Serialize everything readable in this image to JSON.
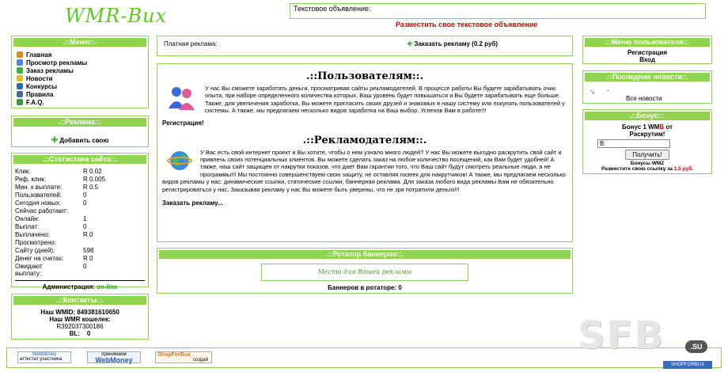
{
  "header": {
    "logo": "WMR-Bux",
    "ad_label": "Текстовое объявление:",
    "ad_link": "Разместить свое текстовое объявление"
  },
  "left": {
    "menu": {
      "title": ".::Меню::.",
      "items": [
        {
          "label": "Главная",
          "icon": "home-icon",
          "color": "#d98a20"
        },
        {
          "label": "Просмотр рекламы",
          "icon": "view-ads-icon",
          "color": "#4a8ad4"
        },
        {
          "label": "Заказ рекламы",
          "icon": "order-icon",
          "color": "#3cb33c"
        },
        {
          "label": "Новости",
          "icon": "news-icon",
          "color": "#e0c020"
        },
        {
          "label": "Конкурсы",
          "icon": "contest-icon",
          "color": "#2a6ab8"
        },
        {
          "label": "Правила",
          "icon": "rules-icon",
          "color": "#4a6a9a"
        },
        {
          "label": "F.A.Q.",
          "icon": "faq-icon",
          "color": "#3c9a3c"
        }
      ]
    },
    "ads": {
      "title": ".::Реклама::.",
      "add": "Добавить свою"
    },
    "stats": {
      "title": ".::Статистика сайта::.",
      "rows": [
        {
          "k": "Клик:",
          "v": "R 0.02"
        },
        {
          "k": "Реф. клик:",
          "v": "R 0.005"
        },
        {
          "k": "Мин. к выплате:",
          "v": "R 0.5"
        },
        {
          "k": "Пользователей:",
          "v": "0"
        },
        {
          "k": "Сегодня новых:",
          "v": "0"
        },
        {
          "k": "Сейчас работают:",
          "v": ""
        },
        {
          "k": "Онлайн:",
          "v": "1"
        },
        {
          "k": "Выплат:",
          "v": "0"
        },
        {
          "k": "Выплачено:",
          "v": "R 0"
        },
        {
          "k": "Просмотрено:",
          "v": ""
        },
        {
          "k": "Сайту (дней):",
          "v": "598"
        },
        {
          "k": "Денег на счетах:",
          "v": "R 0"
        },
        {
          "k": "Ожидают выплату:",
          "v": "0"
        }
      ],
      "admin_label": "Администрация:",
      "admin_status": "on-line"
    },
    "contacts": {
      "title": ".::Контакты::.",
      "wmid": "Наш WMID: 849381610650",
      "purse_label": "Наш WMR кошелек:",
      "purse": "R392037300186",
      "bl": "BL:    0"
    }
  },
  "center": {
    "paid_ads": "Платная реклама:",
    "order_ads": "Заказать рекламу (0.2 руб)",
    "users_title": ".::Пользователям::.",
    "users_text": "У нас Вы сможете заработать деньги, просматривая сайты рекламодателей. В процессе работы Вы будете зарабатывать очки опыта, при наборе определенного количества которых, Ваш уровень будет повышаться и Вы будете зарабатывать еще больше. Также, для увеличения заработка, Вы можете пригласить своих друзей и знакомых в нашу систему или покупать пользователей у системы. А также, мы предлагаем несколько видов заработка на Ваш выбор. Успехов Вам в работе!!!",
    "register": "Регистрация!",
    "adv_title": ".::Рекламодателям::.",
    "adv_text": "У Вас есть свой интернет проект и Вы хотите, чтобы о нем узнало много людей? У нас Вы можете выгодно раскрутить свой сайт и привлечь своих потенциальных клиентов. Вы можете сделать заказ на любое количество посещений, как Вам будет удобней! А также, наш сайт защищен от накрутки показов, что дает Вам гарантии того, что Ваш сайт будут смотреть реальные люди, а не программы!!! Мы постоянно совершенствуем свою защиту, не оставляя лазеек для накрутчиков! А также, мы предлагаем несколько видов рекламы у нас: динамические ссылки, статические ссылки, баннерная реклама. Для заказа любого вида рекламы Вам не обязательно регистрироваться у нас. Заказывая рекламу у нас Вы можете быть уверены, что не зря потратили деньги!!!",
    "order_link": "Заказать рекламу...",
    "rotator_title": ".::Ротатор баннеров::.",
    "rotator_slot": "Место для Вашей рекламы",
    "rotator_count": "Баннеров в ротаторе: 0"
  },
  "right": {
    "user_menu": {
      "title": ".::Меню пользователя::.",
      "register": "Регистрация",
      "login": "Вход"
    },
    "news": {
      "title": ".::Последние новости::.",
      "item": "-",
      "all": "Все новости"
    },
    "bonus": {
      "title": ".::Бонус::.",
      "heading_a": "Бонус 1 WM",
      "heading_b": "B",
      "heading_c": " от",
      "heading_line2": "Раскрутим!",
      "input_value": "B",
      "button": "Получить!",
      "footer": "Бонусы WMZ",
      "ref_text": "Разместите свою ссылку за",
      "ref_price": "1.5 руб."
    }
  },
  "footer": {
    "badge1_a": "WebMoney",
    "badge1_b": "аттестат участника",
    "badge2_a": "принимаем",
    "badge2_b": "WebMoney",
    "badge3_a": "ShopForBux",
    "badge3_b": "создай",
    "watermark": "SFB",
    "watermark_tld": ".SU",
    "shop_label": "SHOPFORBUX"
  }
}
